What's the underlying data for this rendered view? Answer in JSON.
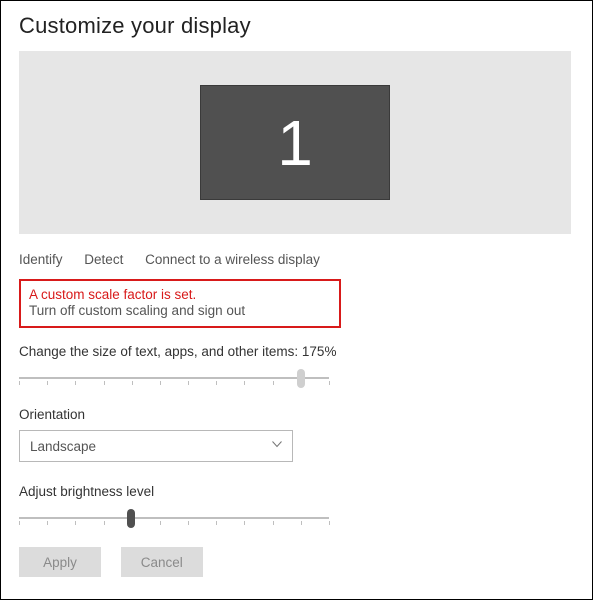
{
  "title": "Customize your display",
  "preview": {
    "monitor_number": "1"
  },
  "links": {
    "identify": "Identify",
    "detect": "Detect",
    "connect_wireless": "Connect to a wireless display"
  },
  "scale_box": {
    "warning": "A custom scale factor is set.",
    "turnoff_link": "Turn off custom scaling and sign out"
  },
  "text_size": {
    "label": "Change the size of text, apps, and other items: 175%",
    "slider_percent": 91
  },
  "orientation": {
    "label": "Orientation",
    "selected": "Landscape"
  },
  "brightness": {
    "label": "Adjust brightness level",
    "slider_percent": 36
  },
  "buttons": {
    "apply": "Apply",
    "cancel": "Cancel"
  }
}
